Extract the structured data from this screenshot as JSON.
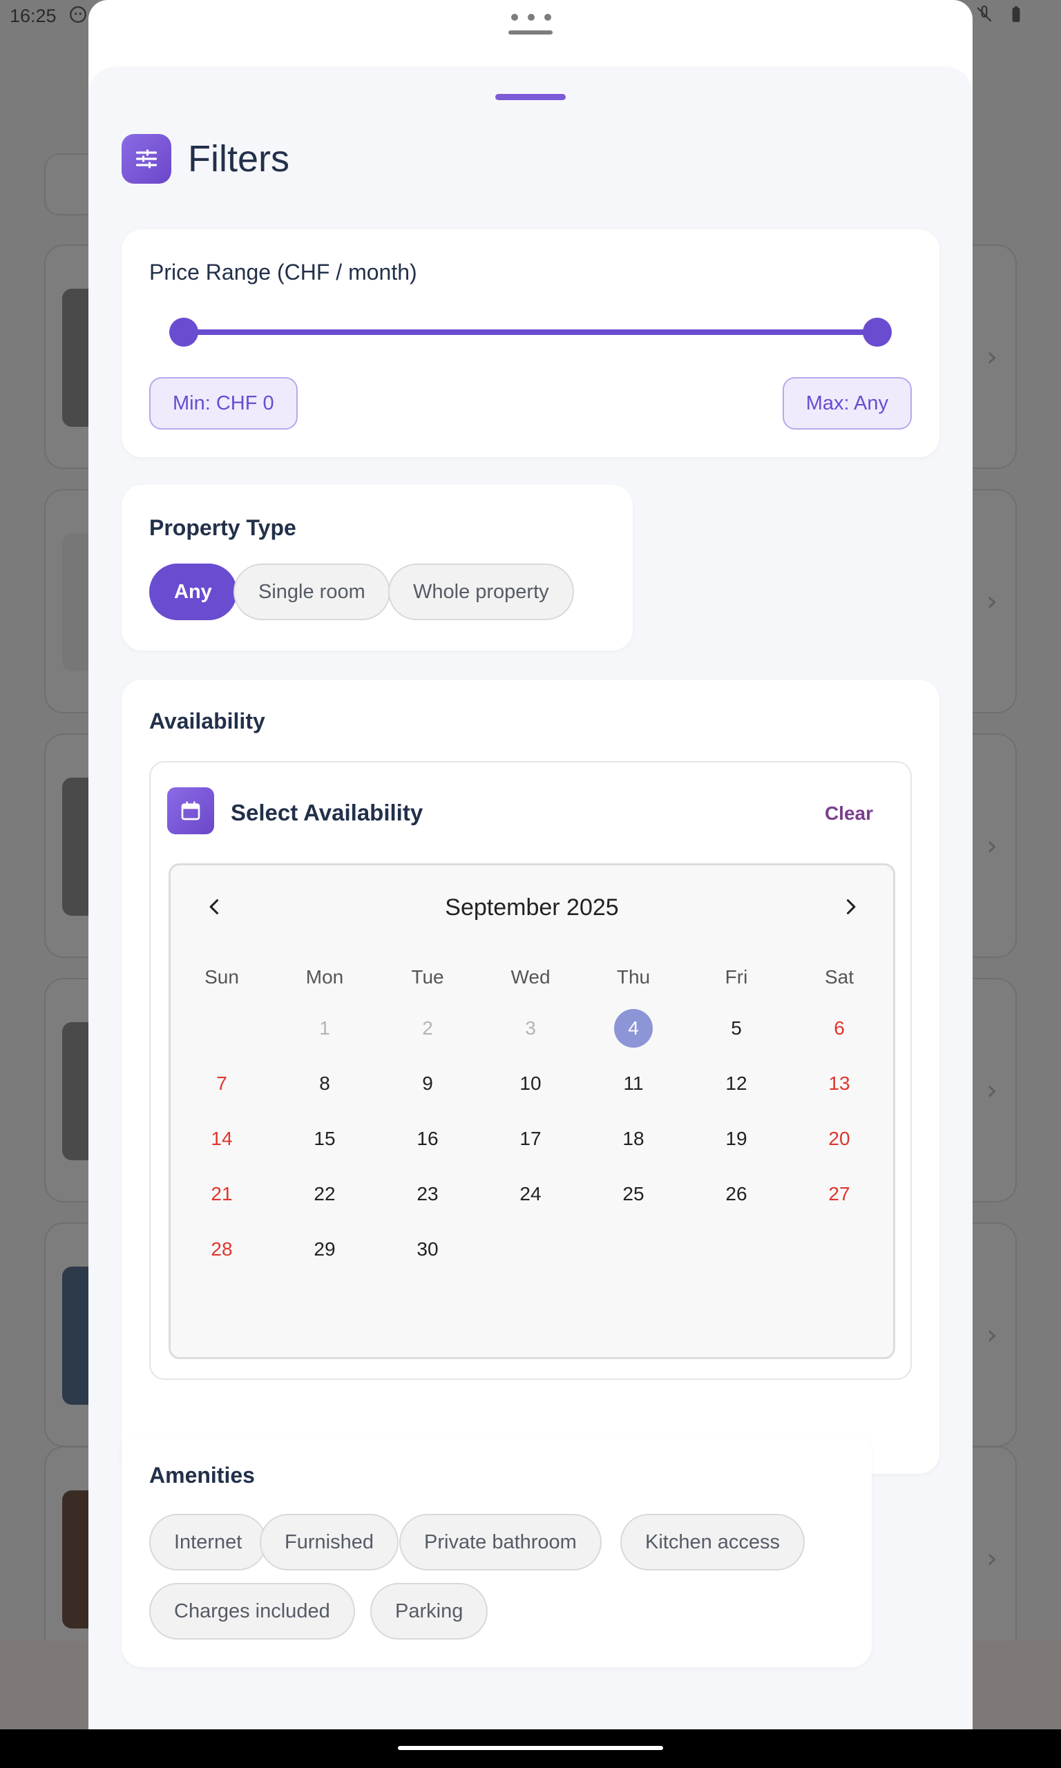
{
  "status_bar": {
    "time": "16:25"
  },
  "filters": {
    "title": "Filters"
  },
  "price_range": {
    "title": "Price Range (CHF / month)",
    "min_label": "Min: CHF 0",
    "max_label": "Max: Any",
    "min_fraction": 0,
    "max_fraction": 1
  },
  "property_type": {
    "title": "Property Type",
    "options": [
      "Any",
      "Single room",
      "Whole property"
    ],
    "selected": "Any"
  },
  "availability": {
    "title": "Availability",
    "box_title": "Select Availability",
    "clear_label": "Clear",
    "calendar": {
      "month_label": "September 2025",
      "weekdays": [
        "Sun",
        "Mon",
        "Tue",
        "Wed",
        "Thu",
        "Fri",
        "Sat"
      ],
      "days": [
        "1",
        "2",
        "3",
        "4",
        "5",
        "6",
        "7",
        "8",
        "9",
        "10",
        "11",
        "12",
        "13",
        "14",
        "15",
        "16",
        "17",
        "18",
        "19",
        "20",
        "21",
        "22",
        "23",
        "24",
        "25",
        "26",
        "27",
        "28",
        "29",
        "30"
      ],
      "today": "4"
    }
  },
  "amenities": {
    "title": "Amenities",
    "options": [
      "Internet",
      "Furnished",
      "Private bathroom",
      "Kitchen access",
      "Charges included",
      "Parking"
    ]
  },
  "colors": {
    "accent": "#6a4cd0",
    "weekend": "#e0352e",
    "today": "#8c95d6",
    "clear": "#7a3f8c"
  }
}
